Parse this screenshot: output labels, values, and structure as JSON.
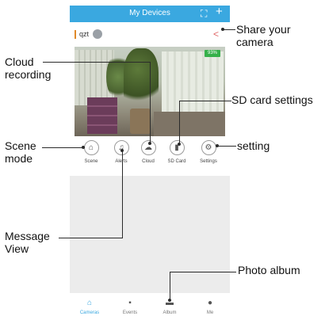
{
  "app": {
    "title": "My Devices"
  },
  "camera": {
    "name": "qzt",
    "battery": "93%"
  },
  "toolbar": {
    "items": [
      {
        "label": "Scene",
        "icon": "home-icon"
      },
      {
        "label": "Alerts",
        "icon": "bell-icon"
      },
      {
        "label": "Cloud",
        "icon": "cloud-icon"
      },
      {
        "label": "SD Card",
        "icon": "sd-card-icon"
      },
      {
        "label": "Settings",
        "icon": "gear-icon"
      }
    ]
  },
  "nav": {
    "items": [
      {
        "label": "Cameras",
        "icon": "home-icon",
        "active": true
      },
      {
        "label": "Events",
        "icon": "message-icon",
        "active": false
      },
      {
        "label": "Album",
        "icon": "album-icon",
        "active": false
      },
      {
        "label": "Me",
        "icon": "person-icon",
        "active": false
      }
    ]
  },
  "annotations": {
    "share": "Share your camera",
    "cloud": "Cloud recording",
    "sd": "SD card settings",
    "scene": "Scene mode",
    "setting": "setting",
    "message": "Message View",
    "photo": "Photo album"
  },
  "colors": {
    "accent": "#3aa8e0",
    "battery": "#36b04a",
    "share": "#e06666",
    "camera_bar": "#e08a2a"
  }
}
